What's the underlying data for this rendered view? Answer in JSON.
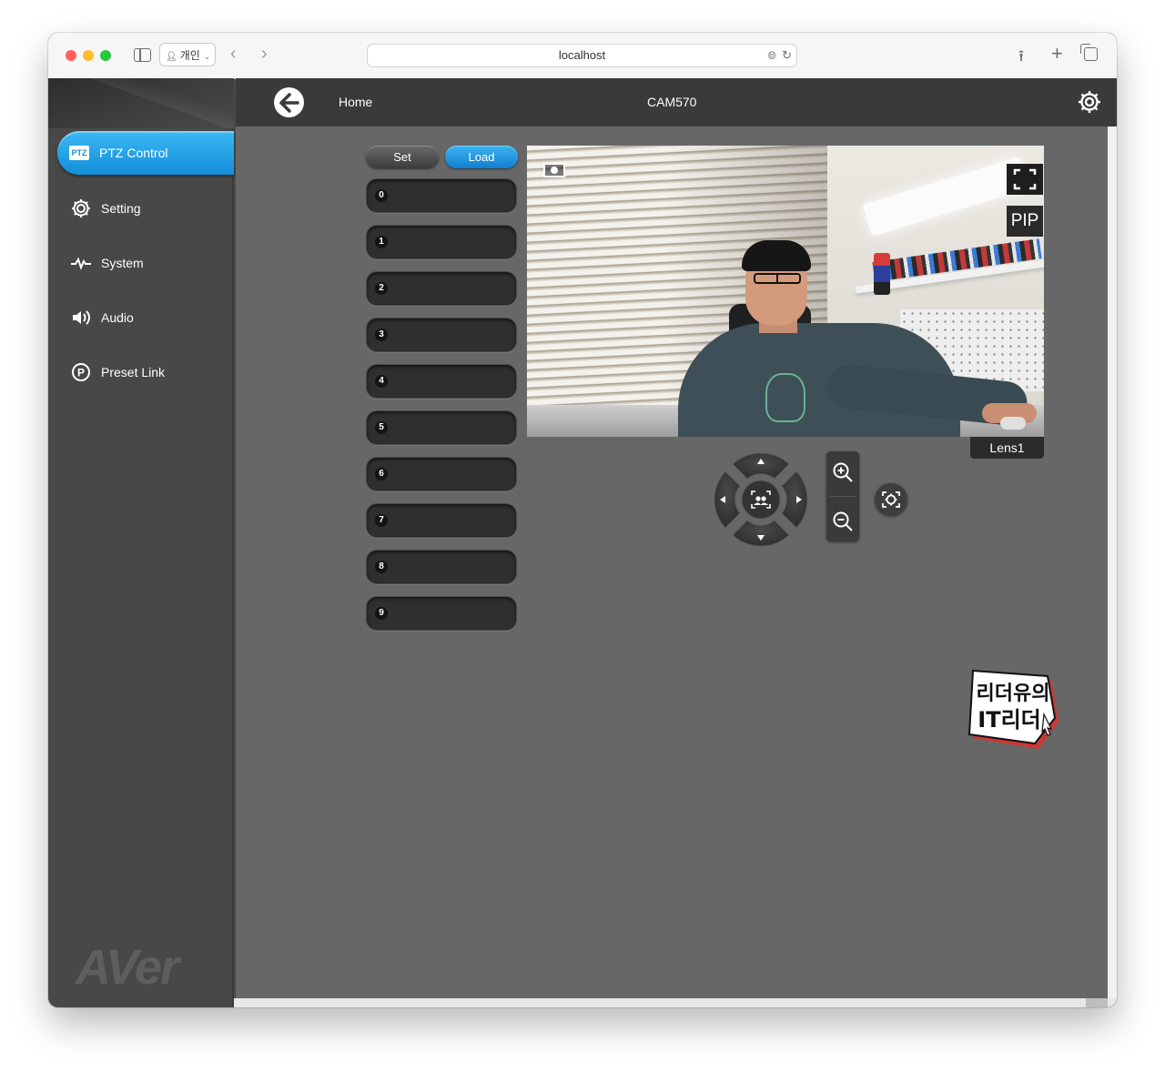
{
  "browser": {
    "profile_label": "개인",
    "url": "localhost"
  },
  "header": {
    "home_label": "Home",
    "device_name": "CAM570"
  },
  "sidebar": {
    "items": [
      {
        "label": "PTZ Control",
        "icon": "ptz-icon",
        "active": true
      },
      {
        "label": "Setting",
        "icon": "gear-icon",
        "active": false
      },
      {
        "label": "System",
        "icon": "pulse-icon",
        "active": false
      },
      {
        "label": "Audio",
        "icon": "speaker-icon",
        "active": false
      },
      {
        "label": "Preset Link",
        "icon": "preset-link-icon",
        "active": false
      }
    ],
    "ptz_badge": "PTZ",
    "brand": "AVer"
  },
  "presets": {
    "set_label": "Set",
    "load_label": "Load",
    "items": [
      "0",
      "1",
      "2",
      "3",
      "4",
      "5",
      "6",
      "7",
      "8",
      "9"
    ]
  },
  "camera": {
    "pip_label": "PIP",
    "lens_label": "Lens1"
  },
  "colors": {
    "accent": "#1a9be6",
    "panel": "#676767",
    "sidebar": "#484848",
    "header": "#3a3a3a"
  },
  "watermark": {
    "line1": "리더유의",
    "line2": "IT리더"
  }
}
